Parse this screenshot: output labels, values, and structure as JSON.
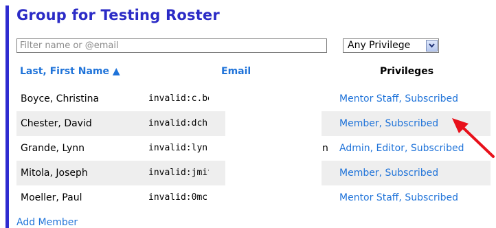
{
  "page": {
    "title": "Group for Testing Roster",
    "accent_color": "#2e2bd0",
    "link_color": "#1f73d9",
    "title_color": "#2b2bc6"
  },
  "filter": {
    "placeholder": "Filter name or @email",
    "value": ""
  },
  "privilege_select": {
    "selected": "Any Privilege",
    "icon": "chevron-down-icon"
  },
  "table": {
    "headers": {
      "name": "Last, First Name ▲",
      "email": "Email",
      "privileges": "Privileges"
    },
    "rows": [
      {
        "name": "Boyce, Christina",
        "email": "invalid:c.bo",
        "email_tail": "",
        "privileges": "Mentor Staff, Subscribed"
      },
      {
        "name": "Chester, David",
        "email": "invalid:dch",
        "email_tail": "",
        "privileges": "Member, Subscribed"
      },
      {
        "name": "Grande, Lynn",
        "email": "invalid:lynr",
        "email_tail": "n",
        "privileges": "Admin, Editor, Subscribed"
      },
      {
        "name": "Mitola, Joseph",
        "email": "invalid:jmit",
        "email_tail": "",
        "privileges": "Member, Subscribed"
      },
      {
        "name": "Moeller, Paul",
        "email": "invalid:0mc",
        "email_tail": "",
        "privileges": "Mentor Staff, Subscribed"
      }
    ]
  },
  "add_member": {
    "label": "Add Member"
  },
  "annotation": {
    "icon": "red-arrow-icon",
    "color": "#e8111b"
  }
}
